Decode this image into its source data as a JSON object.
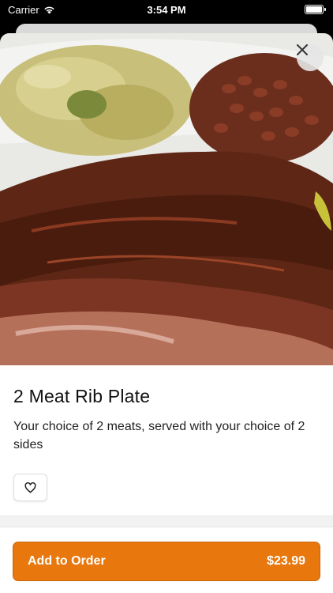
{
  "status_bar": {
    "carrier": "Carrier",
    "time": "3:54 PM",
    "battery_level": 1.0
  },
  "item": {
    "image_alt_icon": "food-photo",
    "title": "2 Meat Rib Plate",
    "description": "Your choice of 2 meats, served with your choice of 2 sides",
    "favorite_icon": "heart-outline-icon"
  },
  "footer": {
    "add_label": "Add to Order",
    "price": "$23.99",
    "accent_color": "#e8780e"
  },
  "close_icon": "close-icon"
}
